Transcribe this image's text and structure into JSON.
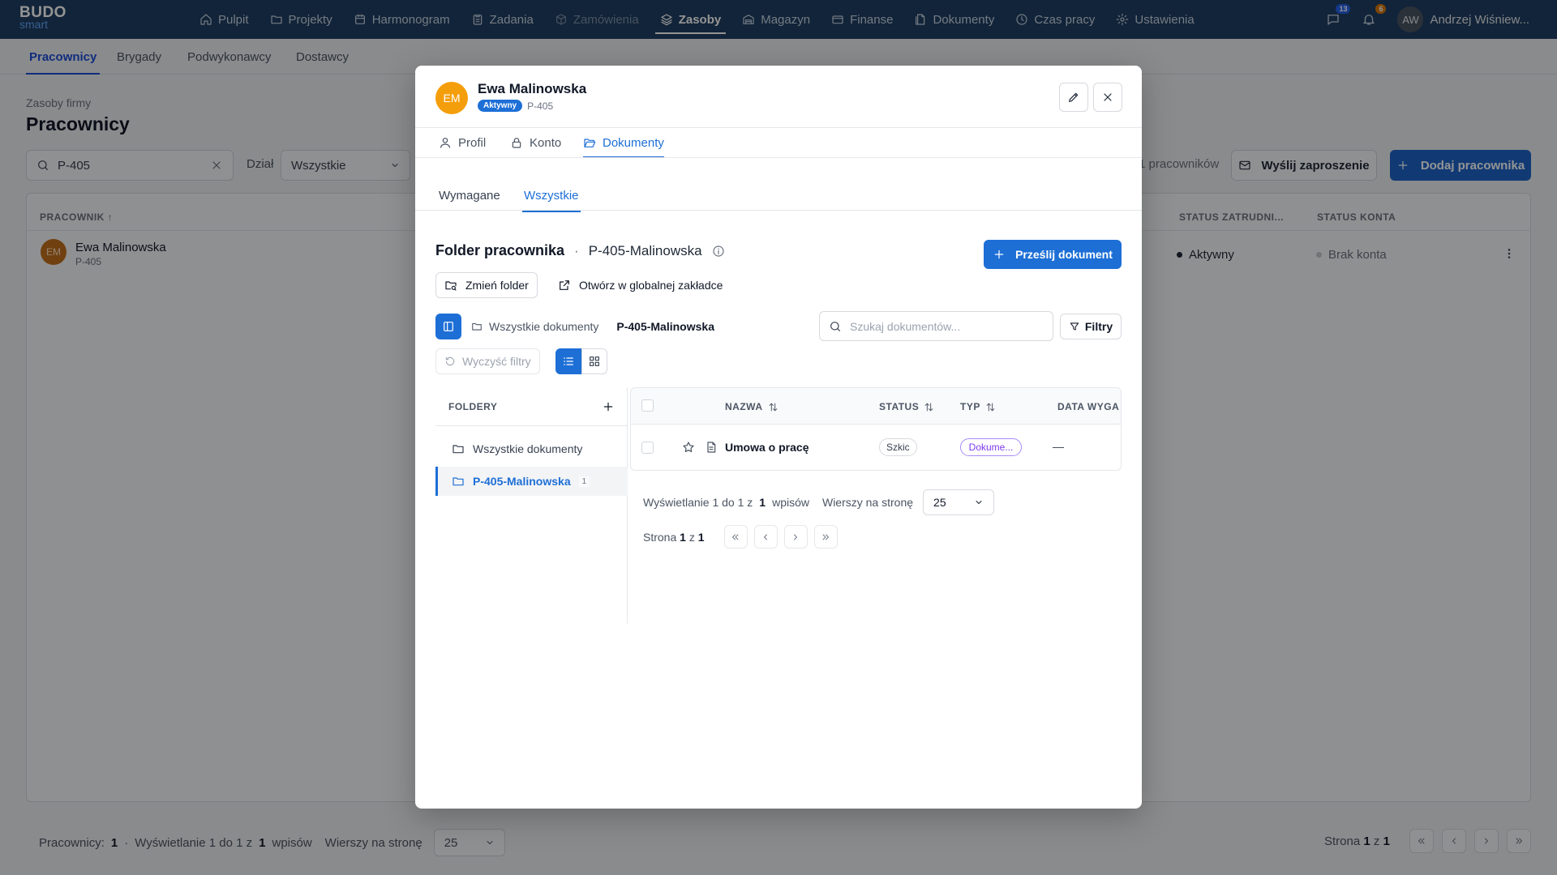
{
  "app": {
    "logo_line1": "BUDO",
    "logo_line2": "smart"
  },
  "nav": {
    "items": [
      {
        "label": "Pulpit",
        "icon": "home-icon"
      },
      {
        "label": "Projekty",
        "icon": "folder-icon"
      },
      {
        "label": "Harmonogram",
        "icon": "calendar-icon"
      },
      {
        "label": "Zadania",
        "icon": "clipboard-icon"
      },
      {
        "label": "Zamówienia",
        "icon": "box-icon"
      },
      {
        "label": "Zasoby",
        "icon": "layers-icon"
      },
      {
        "label": "Magazyn",
        "icon": "warehouse-icon"
      },
      {
        "label": "Finanse",
        "icon": "card-icon"
      },
      {
        "label": "Dokumenty",
        "icon": "documents-icon"
      },
      {
        "label": "Czas pracy",
        "icon": "clock-icon"
      },
      {
        "label": "Ustawienia",
        "icon": "gear-icon"
      }
    ],
    "active": "Zasoby",
    "messages_count": "13",
    "notifications_count": "6",
    "user_initials": "AW",
    "user_name": "Andrzej Wiśniew..."
  },
  "subnav": {
    "tabs": [
      "Pracownicy",
      "Brygady",
      "Podwykonawcy",
      "Dostawcy"
    ],
    "active": "Pracownicy"
  },
  "page": {
    "subtitle": "Zasoby firmy",
    "title": "Pracownicy",
    "search_value": "P-405",
    "dept_label": "Dział",
    "dept_value": "Wszystkie",
    "count_text": "1 pracowników",
    "invite_label": "Wyślij zaproszenie",
    "add_label": "Dodaj pracownika",
    "table": {
      "col_employee": "PRACOWNIK ↑",
      "col_status": "STATUS ZATRUDNI...",
      "col_account": "STATUS KONTA",
      "row": {
        "initials": "EM",
        "name": "Ewa Malinowska",
        "code": "P-405",
        "status": "Aktywny",
        "account": "Brak konta"
      }
    },
    "footer": {
      "employees_label": "Pracownicy:",
      "employees_count": "1",
      "sep": "·",
      "showing_prefix": "Wyświetlanie 1 do 1 z",
      "showing_total": "1",
      "showing_suffix": "wpisów",
      "rows_label": "Wierszy na stronę",
      "rows_value": "25",
      "page_prefix": "Strona",
      "page_cur": "1",
      "page_of": "z",
      "page_total": "1"
    }
  },
  "modal": {
    "initials": "EM",
    "name": "Ewa Malinowska",
    "status_badge": "Aktywny",
    "code": "P-405",
    "tabs": [
      "Profil",
      "Konto",
      "Dokumenty"
    ],
    "active_tab": "Dokumenty",
    "subtabs": [
      "Wymagane",
      "Wszystkie"
    ],
    "active_subtab": "Wszystkie",
    "folder_title": "Folder pracownika",
    "folder_sep": "·",
    "folder_name": "P-405-Malinowska",
    "upload_label": "Prześlij dokument",
    "change_folder_label": "Zmień folder",
    "open_global_label": "Otwórz w globalnej zakładce",
    "crumb_root": "Wszystkie dokumenty",
    "crumb_current": "P-405-Malinowska",
    "search_placeholder": "Szukaj dokumentów...",
    "filters_label": "Filtry",
    "clear_filters_label": "Wyczyść filtry",
    "folders_header": "FOLDERY",
    "folders": [
      {
        "label": "Wszystkie dokumenty",
        "count": ""
      },
      {
        "label": "P-405-Malinowska",
        "count": "1"
      }
    ],
    "table": {
      "col_name": "NAZWA",
      "col_status": "STATUS",
      "col_type": "TYP",
      "col_expiry": "DATA WYGA",
      "row": {
        "name": "Umowa o pracę",
        "status": "Szkic",
        "type": "Dokume...",
        "expiry": "—"
      }
    },
    "showing_prefix": "Wyświetlanie 1 do 1 z",
    "showing_total": "1",
    "showing_suffix": "wpisów",
    "rows_label": "Wierszy na stronę",
    "rows_value": "25",
    "page_prefix": "Strona",
    "page_cur": "1",
    "page_of": "z",
    "page_total": "1"
  },
  "colors": {
    "nav_bg": "#1f3f63",
    "primary": "#1d6fd6",
    "avatar_orange": "#f59e0b",
    "type_purple": "#7c3aed"
  }
}
